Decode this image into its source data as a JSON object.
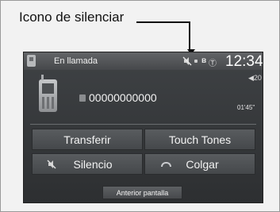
{
  "callout": {
    "label": "Icono de silenciar"
  },
  "statusbar": {
    "title": "En llamada",
    "bluetooth": "ʙ",
    "signal": "Ⓣ",
    "clock": "12:34"
  },
  "call": {
    "number": "00000000000",
    "volume": "◀20",
    "elapsed": "01'45\""
  },
  "buttons": {
    "transfer": "Transferir",
    "touch_tones": "Touch Tones",
    "mute": "Silencio",
    "hang_up": "Colgar",
    "back": "Anterior pantalla"
  },
  "colors": {
    "screen_bg": "#2d2f31",
    "button_bg": "#4f5255",
    "text": "#f3f3f3"
  },
  "icons": {
    "mute": "mute-icon",
    "bluetooth": "bluetooth-icon",
    "signal": "signal-icon",
    "phone": "phone-icon",
    "hang_up": "hang-up-icon"
  }
}
